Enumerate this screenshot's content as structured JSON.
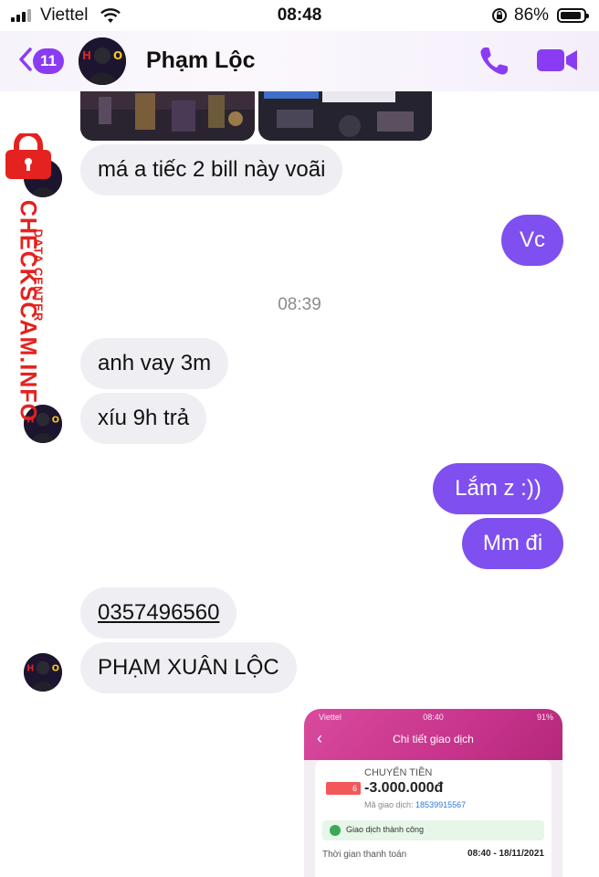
{
  "status_bar": {
    "carrier": "Viettel",
    "time": "08:48",
    "battery": "86%",
    "battery_level": 0.86
  },
  "header": {
    "back_count": "11",
    "contact_name": "Phạm Lộc",
    "icons": [
      "back-chevron-icon",
      "phone-icon",
      "video-camera-icon"
    ]
  },
  "messages": {
    "m1": "má a tiếc 2 bill này voãi",
    "m2": "Vc",
    "timestamp": "08:39",
    "m3": "anh vay 3m",
    "m4": "xíu 9h trả",
    "m5": "Lắm z :))",
    "m6": "Mm đi",
    "m7": "0357496560",
    "m8": "PHẠM XUÂN LỘC"
  },
  "watermark": {
    "main": "CHECKSCAM.INFO",
    "sub": "DATA CENTER"
  },
  "receipt": {
    "carrier": "Viettel",
    "time": "08:40",
    "battery": "91%",
    "title": "Chi tiết giao dịch",
    "type": "CHUYỂN TIỀN",
    "amount": "-3.000.000đ",
    "code_label": "Mã giao dịch:",
    "code": "18539915567",
    "status": "Giao dịch thành công",
    "time_label": "Thời gian thanh toán",
    "time_value": "08:40 - 18/11/2021"
  },
  "colors": {
    "accent": "#8a3cf2",
    "outgoing_bubble": "#7f4ff0",
    "incoming_bubble": "#efeef3",
    "watermark": "#e4221f"
  }
}
